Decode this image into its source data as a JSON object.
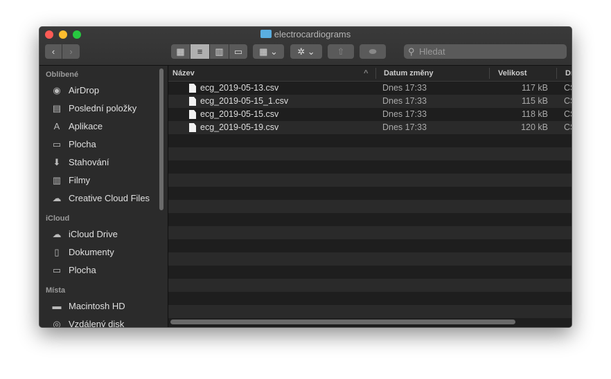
{
  "window": {
    "title": "electrocardiograms"
  },
  "toolbar": {
    "back": "‹",
    "forward": "›",
    "search_placeholder": "Hledat"
  },
  "sidebar": {
    "sections": [
      {
        "title": "Oblíbené",
        "items": [
          {
            "label": "AirDrop",
            "icon": "airdrop-icon"
          },
          {
            "label": "Poslední položky",
            "icon": "recents-icon"
          },
          {
            "label": "Aplikace",
            "icon": "applications-icon"
          },
          {
            "label": "Plocha",
            "icon": "desktop-icon"
          },
          {
            "label": "Stahování",
            "icon": "downloads-icon"
          },
          {
            "label": "Filmy",
            "icon": "movies-icon"
          },
          {
            "label": "Creative Cloud Files",
            "icon": "creative-cloud-icon"
          }
        ]
      },
      {
        "title": "iCloud",
        "items": [
          {
            "label": "iCloud Drive",
            "icon": "cloud-icon"
          },
          {
            "label": "Dokumenty",
            "icon": "documents-icon"
          },
          {
            "label": "Plocha",
            "icon": "desktop-icon"
          }
        ]
      },
      {
        "title": "Místa",
        "items": [
          {
            "label": "Macintosh HD",
            "icon": "disk-icon"
          },
          {
            "label": "Vzdálený disk",
            "icon": "remote-disk-icon"
          }
        ]
      }
    ]
  },
  "columns": {
    "name": "Název",
    "date": "Datum změny",
    "size": "Velikost",
    "kind": "Dr"
  },
  "files": [
    {
      "name": "ecg_2019-05-13.csv",
      "date": "Dnes 17:33",
      "size": "117 kB",
      "kind": "CS"
    },
    {
      "name": "ecg_2019-05-15_1.csv",
      "date": "Dnes 17:33",
      "size": "115 kB",
      "kind": "CS"
    },
    {
      "name": "ecg_2019-05-15.csv",
      "date": "Dnes 17:33",
      "size": "118 kB",
      "kind": "CS"
    },
    {
      "name": "ecg_2019-05-19.csv",
      "date": "Dnes 17:33",
      "size": "120 kB",
      "kind": "CS"
    }
  ]
}
